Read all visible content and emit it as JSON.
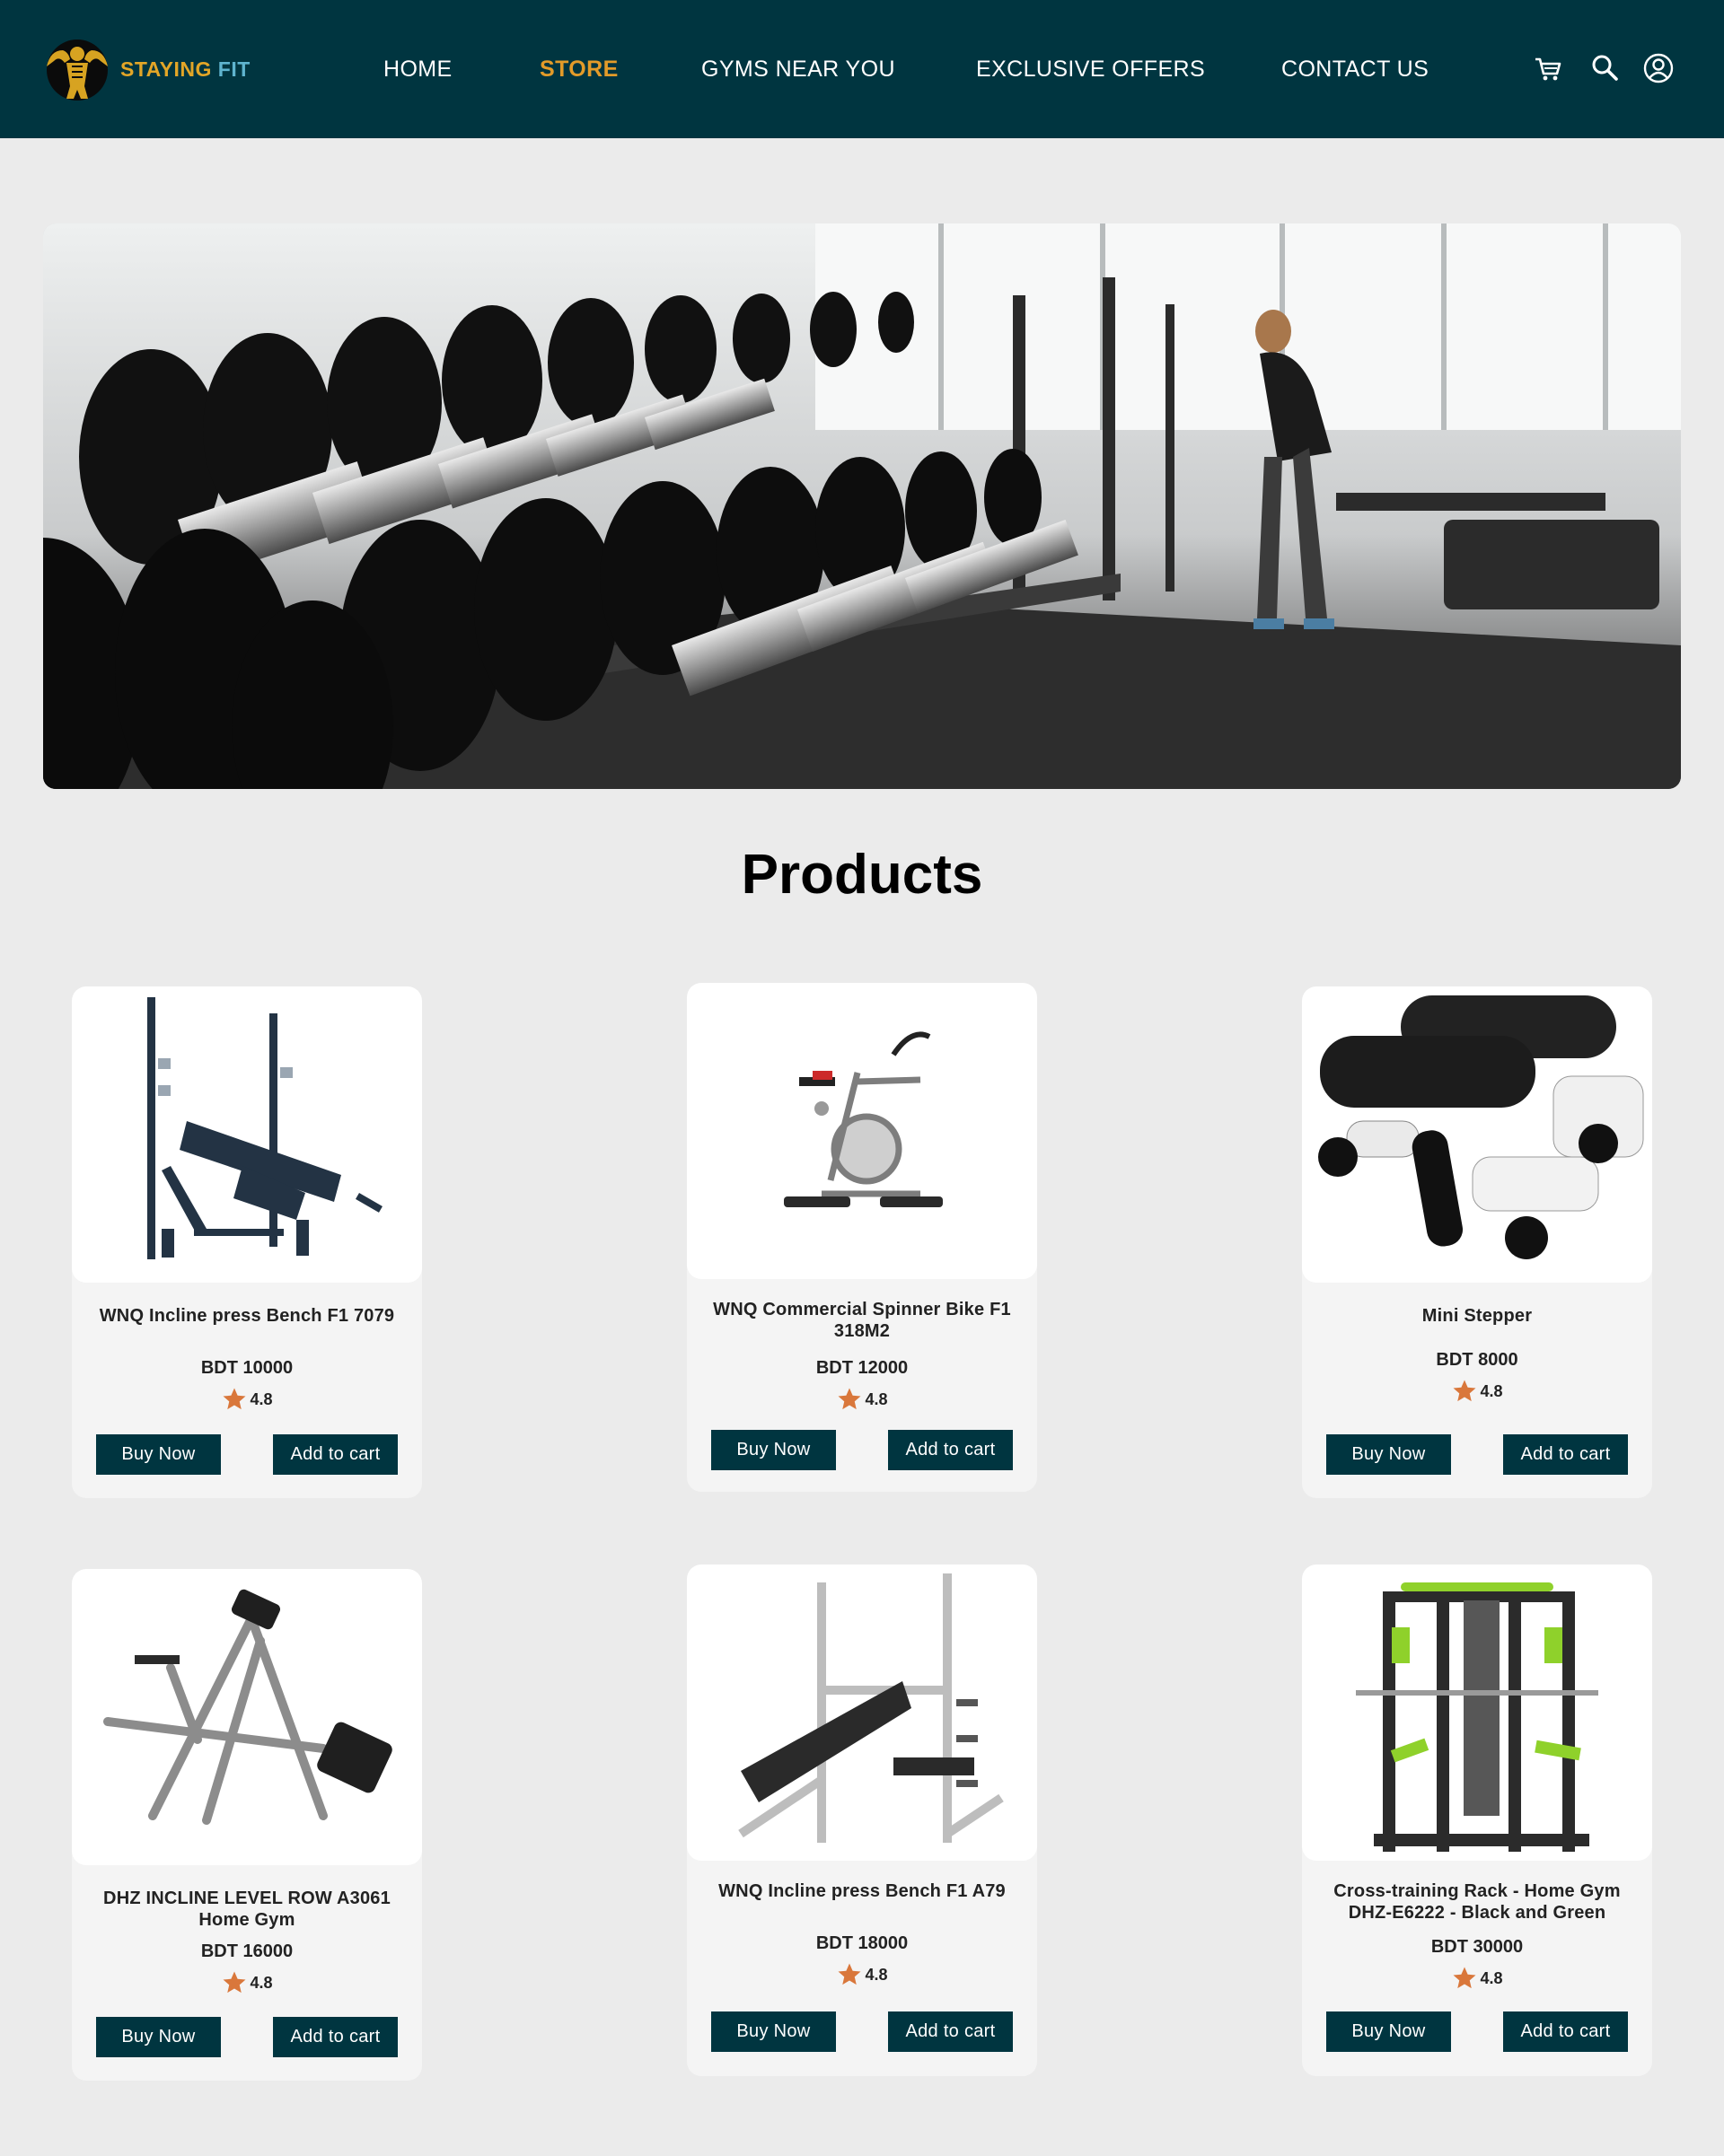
{
  "brand": {
    "name_part1": "STAYING",
    "name_part2": " FIT"
  },
  "nav": {
    "home": "HOME",
    "store": "STORE",
    "gyms": "GYMS NEAR YOU",
    "offers": "EXCLUSIVE OFFERS",
    "contact": "CONTACT US"
  },
  "page_title": "Products",
  "buttons": {
    "buy_now": "Buy Now",
    "add_to_cart": "Add to cart"
  },
  "products": [
    {
      "name": "WNQ Incline press Bench F1 7079",
      "price": "BDT 10000",
      "rating": "4.8"
    },
    {
      "name": "WNQ Commercial Spinner Bike F1 318M2",
      "price": "BDT 12000",
      "rating": "4.8"
    },
    {
      "name": "Mini Stepper",
      "price": "BDT 8000",
      "rating": "4.8"
    },
    {
      "name": "DHZ INCLINE LEVEL ROW A3061 Home Gym",
      "price": "BDT 16000",
      "rating": "4.8"
    },
    {
      "name": "WNQ Incline press Bench F1 A79",
      "price": "BDT 18000",
      "rating": "4.8"
    },
    {
      "name": "Cross-training Rack - Home Gym DHZ-E6222 - Black and Green",
      "price": "BDT 30000",
      "rating": "4.8"
    }
  ],
  "colors": {
    "nav_bg": "#003540",
    "active_nav": "#e39b29",
    "button_bg": "#003540",
    "star": "#d9773b"
  }
}
